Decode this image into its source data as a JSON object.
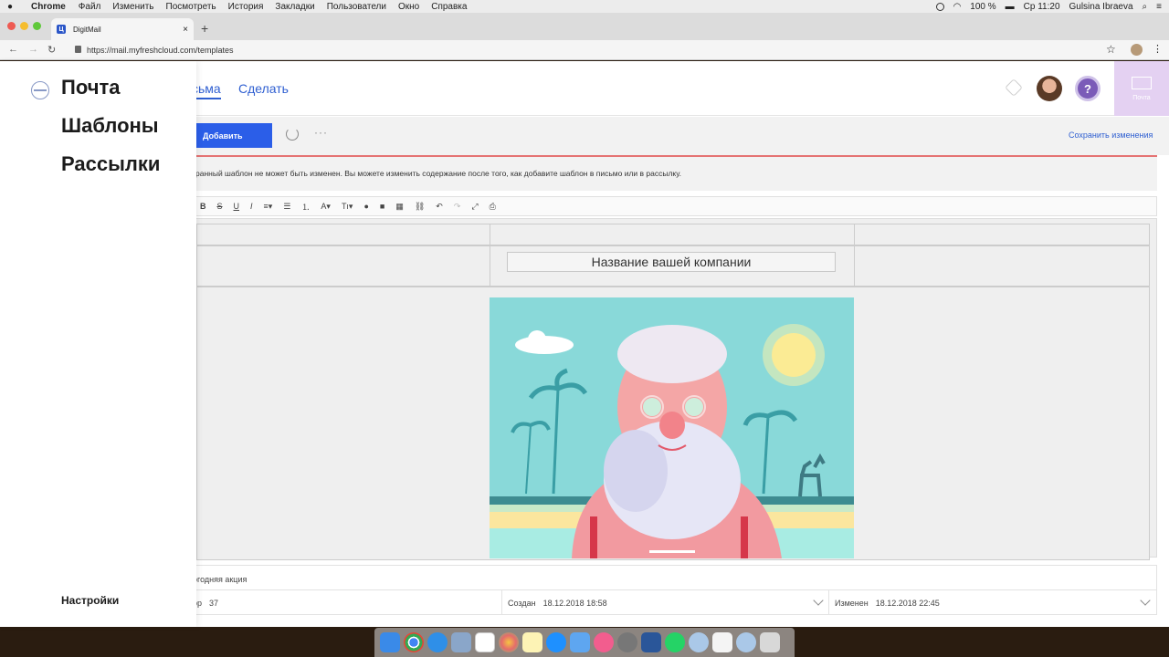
{
  "menubar": {
    "app": "Chrome",
    "items": [
      "Файл",
      "Изменить",
      "Посмотреть",
      "История",
      "Закладки",
      "Пользователи",
      "Окно",
      "Справка"
    ],
    "battery": "100 %",
    "clock": "Ср 11:20",
    "user": "Gulsina Ibraeva"
  },
  "browser": {
    "tab_title": "DigitMail",
    "tab_favicon": "Ц",
    "url": "https://mail.myfreshcloud.com/templates"
  },
  "header": {
    "tabs": [
      {
        "label": "сьма"
      },
      {
        "label": "Сделать"
      }
    ],
    "help_label": "?",
    "mail_tile_label": "Почта"
  },
  "toolbar": {
    "add_label": "Добавить",
    "more_label": "···",
    "save_label": "Сохранить изменения"
  },
  "notice": "ранный шаблон не может быть изменен. Вы можете изменить содержание после того, как добавите шаблон в письмо или в рассылку.",
  "editor": {
    "tools": [
      "B",
      "S",
      "U",
      "I",
      "≡▾",
      "☰",
      "⒈",
      "A▾",
      "Tı▾",
      "●",
      "■",
      "▦",
      "⛓",
      "↶",
      "↷",
      "⤢",
      "⎙"
    ],
    "company_name": "Название вашей компании"
  },
  "footer": {
    "name": "огодняя акция",
    "author_label": "ор",
    "author_value": "37",
    "created_label": "Создан",
    "created_value": "18.12.2018 18:58",
    "modified_label": "Изменен",
    "modified_value": "18.12.2018 22:45"
  },
  "sidebar": {
    "items": [
      {
        "label": "Почта"
      },
      {
        "label": "Шаблоны"
      },
      {
        "label": "Рассылки"
      }
    ],
    "settings_label": "Настройки"
  },
  "colors": {
    "accent": "#2b5ee8",
    "link": "#2f5fd1",
    "notice_border": "#e57373",
    "help": "#7b5bb8",
    "mail_tile": "#e4d1f2"
  },
  "dock": {
    "icons": [
      "finder-icon",
      "chrome-icon",
      "safari-icon",
      "preview-icon",
      "calendar-icon",
      "photos-icon",
      "notes-icon",
      "appstore-icon",
      "mail-icon",
      "itunes-icon",
      "settings-icon",
      "word-icon",
      "whatsapp-icon",
      "app-icon",
      "files-icon",
      "app-icon",
      "trash-icon"
    ]
  }
}
